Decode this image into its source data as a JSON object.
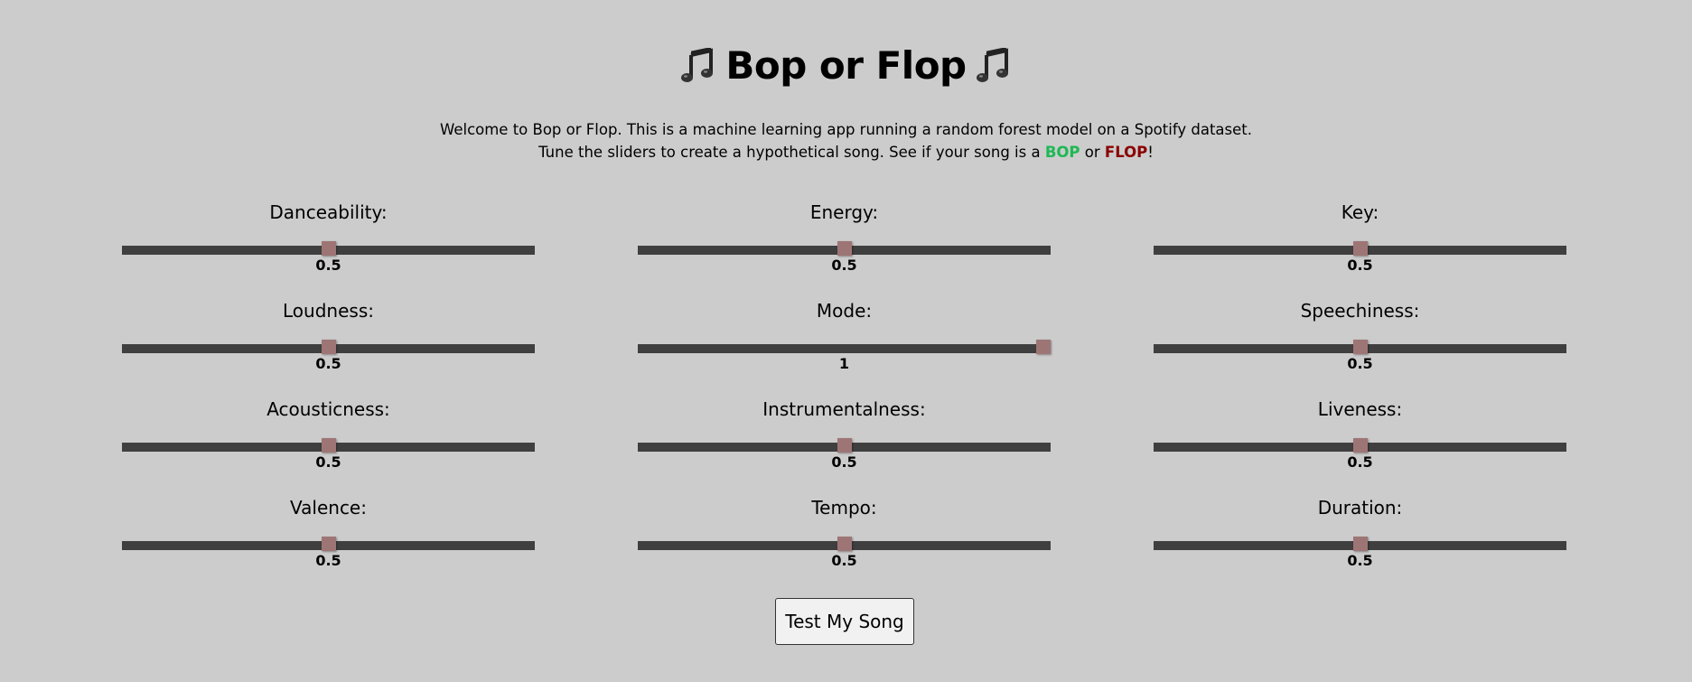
{
  "header": {
    "title": "Bop or Flop",
    "note_icon": "music-note-icon"
  },
  "intro": {
    "line1": "Welcome to Bop or Flop. This is a machine learning app running a random forest model on a Spotify dataset.",
    "line2_prefix": "Tune the sliders to create a hypothetical song. See if your song is a",
    "bop": "BOP",
    "or": "or",
    "flop": "FLOP",
    "suffix": "!"
  },
  "colors": {
    "bop": "#1db954",
    "flop": "#8b0000",
    "track": "#3f3f3f",
    "thumb": "#9e7575",
    "background": "#cccccc"
  },
  "sliders": [
    {
      "label": "Danceability:",
      "value": "0.5",
      "fraction": 0.5
    },
    {
      "label": "Energy:",
      "value": "0.5",
      "fraction": 0.5
    },
    {
      "label": "Key:",
      "value": "0.5",
      "fraction": 0.5
    },
    {
      "label": "Loudness:",
      "value": "0.5",
      "fraction": 0.5
    },
    {
      "label": "Mode:",
      "value": "1",
      "fraction": 1.0
    },
    {
      "label": "Speechiness:",
      "value": "0.5",
      "fraction": 0.5
    },
    {
      "label": "Acousticness:",
      "value": "0.5",
      "fraction": 0.5
    },
    {
      "label": "Instrumentalness:",
      "value": "0.5",
      "fraction": 0.5
    },
    {
      "label": "Liveness:",
      "value": "0.5",
      "fraction": 0.5
    },
    {
      "label": "Valence:",
      "value": "0.5",
      "fraction": 0.5
    },
    {
      "label": "Tempo:",
      "value": "0.5",
      "fraction": 0.5
    },
    {
      "label": "Duration:",
      "value": "0.5",
      "fraction": 0.5
    }
  ],
  "submit_label": "Test My Song"
}
